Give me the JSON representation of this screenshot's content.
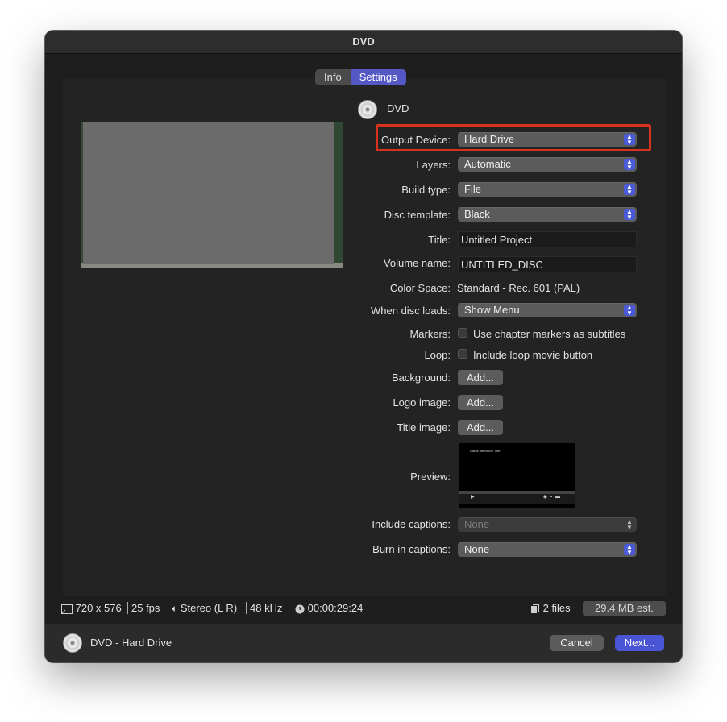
{
  "window": {
    "title": "DVD"
  },
  "tabs": [
    {
      "label": "Info",
      "active": false
    },
    {
      "label": "Settings",
      "active": true
    }
  ],
  "header": {
    "icon": "dvd-disc-icon",
    "title": "DVD"
  },
  "settings": {
    "output_device": {
      "label": "Output Device:",
      "value": "Hard Drive"
    },
    "layers": {
      "label": "Layers:",
      "value": "Automatic"
    },
    "build_type": {
      "label": "Build type:",
      "value": "File"
    },
    "disc_template": {
      "label": "Disc template:",
      "value": "Black"
    },
    "title": {
      "label": "Title:",
      "value": "Untitled Project"
    },
    "volume_name": {
      "label": "Volume name:",
      "value": "UNTITLED_DISC"
    },
    "color_space": {
      "label": "Color Space:",
      "value": "Standard - Rec. 601 (PAL)"
    },
    "when_disc_loads": {
      "label": "When disc loads:",
      "value": "Show Menu"
    },
    "markers": {
      "label": "Markers:",
      "checkbox_label": "Use chapter markers as subtitles",
      "checked": false
    },
    "loop": {
      "label": "Loop:",
      "checkbox_label": "Include loop movie button",
      "checked": false
    },
    "background": {
      "label": "Background:",
      "button": "Add..."
    },
    "logo_image": {
      "label": "Logo image:",
      "button": "Add..."
    },
    "title_image": {
      "label": "Title image:",
      "button": "Add..."
    },
    "preview": {
      "label": "Preview:",
      "movie_title": "This is the Movie Title"
    },
    "include_captions": {
      "label": "Include captions:",
      "value": "None",
      "enabled": false
    },
    "burn_in_captions": {
      "label": "Burn in captions:",
      "value": "None"
    }
  },
  "status": {
    "resolution": "720 x 576",
    "fps": "25 fps",
    "audio": "Stereo (L R)",
    "sample_rate": "48 kHz",
    "duration": "00:00:29:24",
    "files": "2 files",
    "size": "29.4 MB est."
  },
  "footer": {
    "destination": "DVD - Hard Drive",
    "cancel": "Cancel",
    "next": "Next..."
  },
  "colors": {
    "accent": "#5458c4",
    "highlight": "#d9331f"
  }
}
